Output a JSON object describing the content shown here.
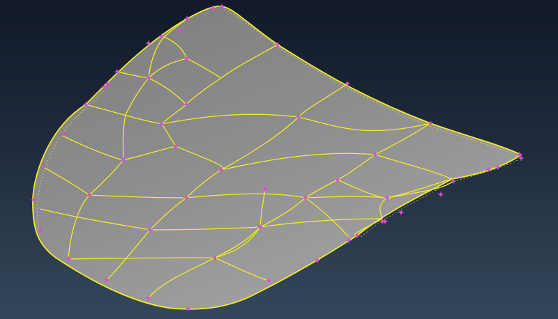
{
  "scene": {
    "object": "surface-mesh",
    "view": "isometric",
    "colors": {
      "background_top": "#11192a",
      "background_bottom": "#34475b",
      "surface_fill": "#8e8e8e",
      "edge_line": "#f2ec2a",
      "node_marker": "#d64fd6"
    }
  }
}
